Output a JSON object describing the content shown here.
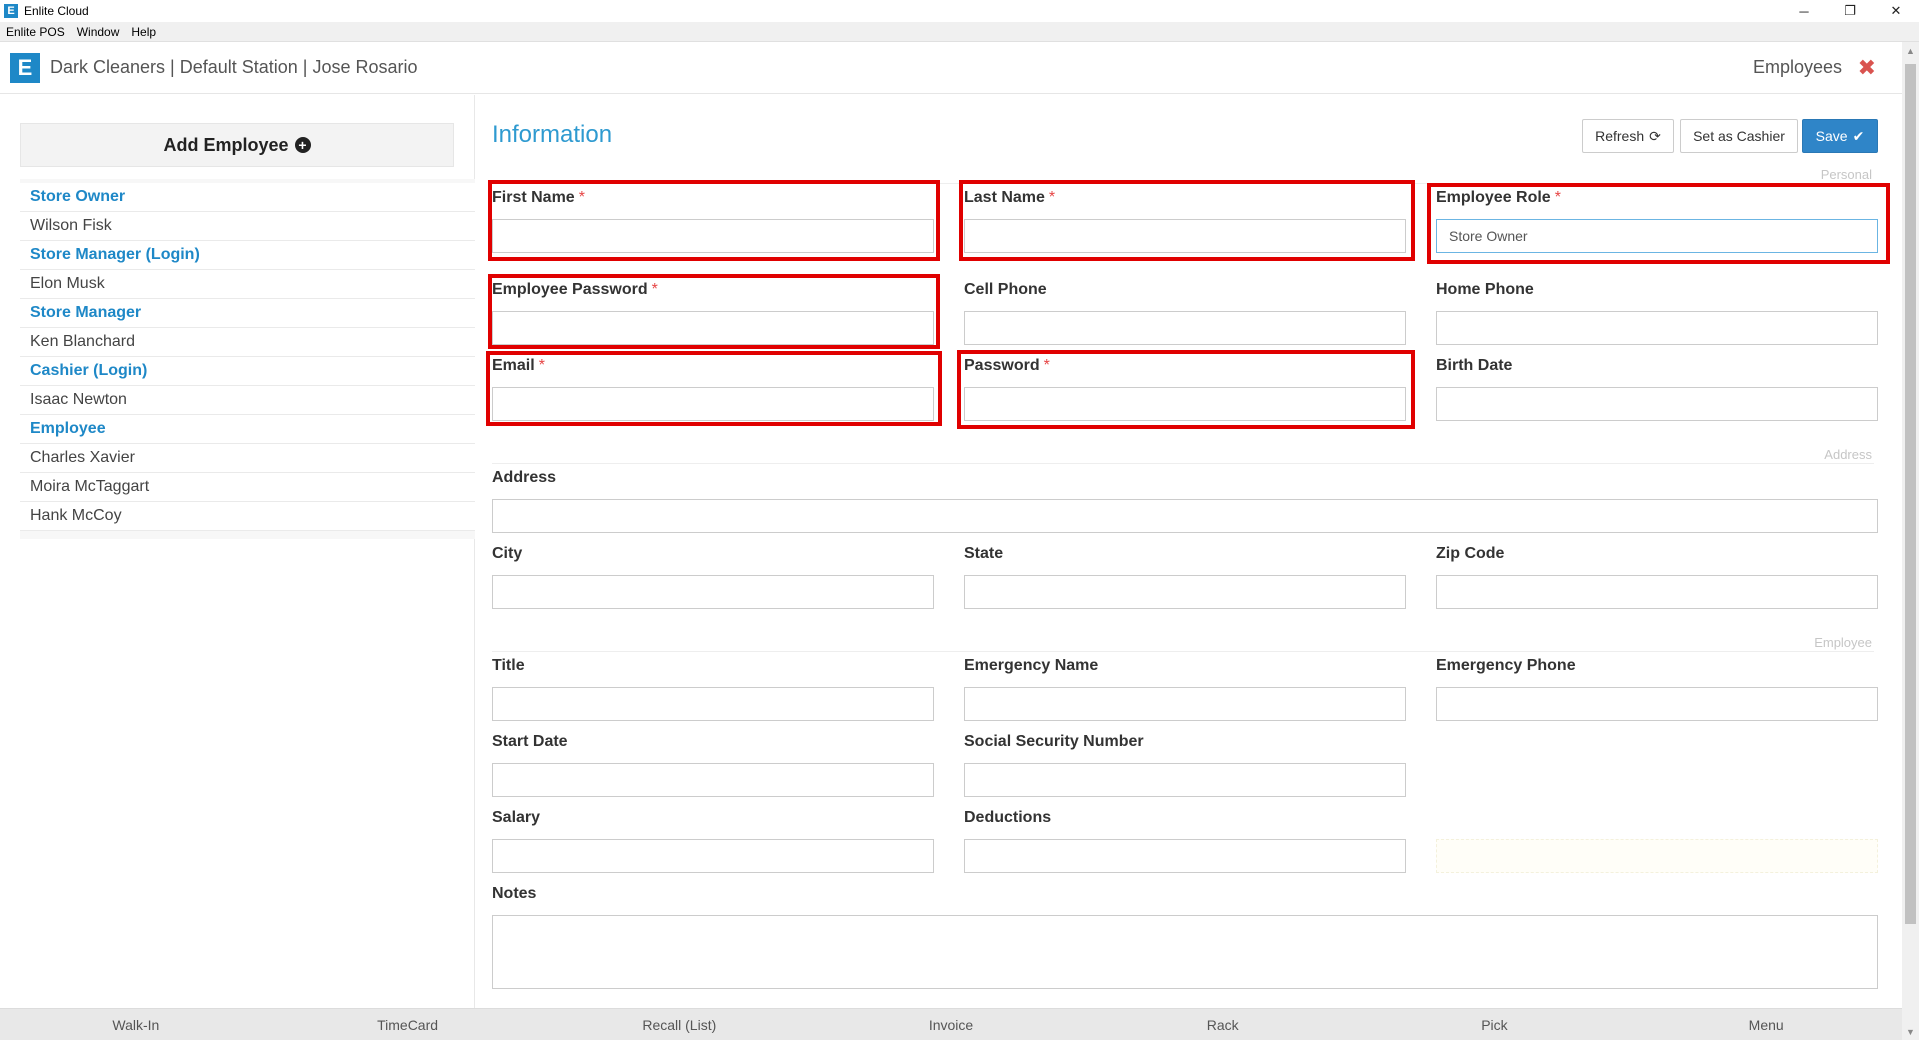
{
  "window": {
    "title": "Enlite Cloud",
    "controls": [
      "─",
      "❐",
      "✕"
    ]
  },
  "menubar": [
    "Enlite POS",
    "Window",
    "Help"
  ],
  "header": {
    "context": "Dark Cleaners | Default Station | Jose Rosario",
    "section": "Employees",
    "close_glyph": "✖"
  },
  "sidebar": {
    "add_label": "Add Employee",
    "items": [
      {
        "text": "Store Owner",
        "kind": "group"
      },
      {
        "text": "Wilson Fisk",
        "kind": "person"
      },
      {
        "text": "Store Manager (Login)",
        "kind": "group"
      },
      {
        "text": "Elon Musk",
        "kind": "person"
      },
      {
        "text": "Store Manager",
        "kind": "group"
      },
      {
        "text": "Ken Blanchard",
        "kind": "person"
      },
      {
        "text": "Cashier (Login)",
        "kind": "group"
      },
      {
        "text": "Isaac Newton",
        "kind": "person"
      },
      {
        "text": "Employee",
        "kind": "group"
      },
      {
        "text": "Charles Xavier",
        "kind": "person"
      },
      {
        "text": "Moira McTaggart",
        "kind": "person"
      },
      {
        "text": "Hank McCoy",
        "kind": "person"
      }
    ]
  },
  "form": {
    "title": "Information",
    "buttons": {
      "refresh": "Refresh",
      "cashier": "Set as Cashier",
      "save": "Save"
    },
    "sections": {
      "personal": "Personal",
      "address": "Address",
      "employee": "Employee"
    },
    "required_mark": "*",
    "fields": {
      "first_name": {
        "label": "First Name",
        "value": ""
      },
      "last_name": {
        "label": "Last Name",
        "value": ""
      },
      "employee_role": {
        "label": "Employee Role",
        "value": "Store Owner"
      },
      "employee_password": {
        "label": "Employee Password",
        "value": ""
      },
      "cell_phone": {
        "label": "Cell Phone",
        "value": ""
      },
      "home_phone": {
        "label": "Home Phone",
        "value": ""
      },
      "email": {
        "label": "Email",
        "value": ""
      },
      "password": {
        "label": "Password",
        "value": ""
      },
      "birth_date": {
        "label": "Birth Date",
        "value": ""
      },
      "address": {
        "label": "Address",
        "value": ""
      },
      "city": {
        "label": "City",
        "value": ""
      },
      "state": {
        "label": "State",
        "value": ""
      },
      "zip": {
        "label": "Zip Code",
        "value": ""
      },
      "title": {
        "label": "Title",
        "value": ""
      },
      "emergency_name": {
        "label": "Emergency Name",
        "value": ""
      },
      "emergency_phone": {
        "label": "Emergency Phone",
        "value": ""
      },
      "start_date": {
        "label": "Start Date",
        "value": ""
      },
      "ssn": {
        "label": "Social Security Number",
        "value": ""
      },
      "salary": {
        "label": "Salary",
        "value": ""
      },
      "deductions": {
        "label": "Deductions",
        "value": ""
      },
      "notes": {
        "label": "Notes",
        "value": ""
      }
    }
  },
  "bottomnav": [
    "Walk-In",
    "TimeCard",
    "Recall (List)",
    "Invoice",
    "Rack",
    "Pick",
    "Menu"
  ],
  "colors": {
    "accent": "#1e88c7",
    "highlight_box": "#e00000",
    "required": "#e64545",
    "save_button": "#2f85c8"
  }
}
